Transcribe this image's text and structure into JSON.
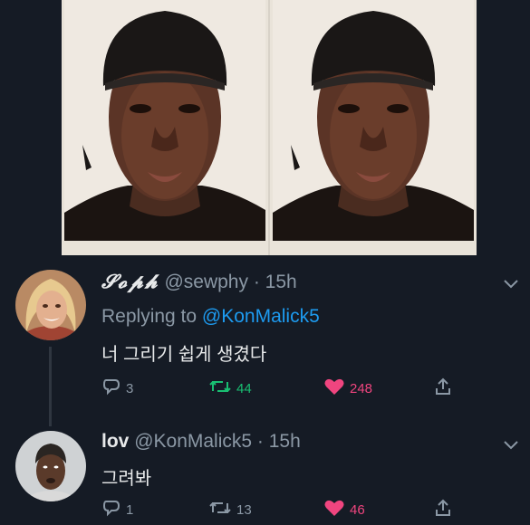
{
  "tweets": [
    {
      "display_name": "𝓢𝓸𝓹𝓱",
      "handle": "@sewphy",
      "separator": "·",
      "time": "15h",
      "replying_prefix": "Replying to",
      "replying_to": "@KonMalick5",
      "text": "너 그리기 쉽게 생겼다",
      "replies": "3",
      "retweets": "44",
      "likes": "248"
    },
    {
      "display_name": "lov",
      "handle": "@KonMalick5",
      "separator": "·",
      "time": "15h",
      "text": "그려봐",
      "replies": "1",
      "retweets": "13",
      "likes": "46"
    }
  ],
  "colors": {
    "background": "#151b25",
    "secondary_text": "#8b98a5",
    "link": "#1d9bf0",
    "retweet_active": "#19bf72",
    "like_active": "#f0457f"
  },
  "icons": [
    "reply-icon",
    "retweet-icon",
    "heart-icon",
    "share-icon",
    "chevron-down-icon"
  ]
}
